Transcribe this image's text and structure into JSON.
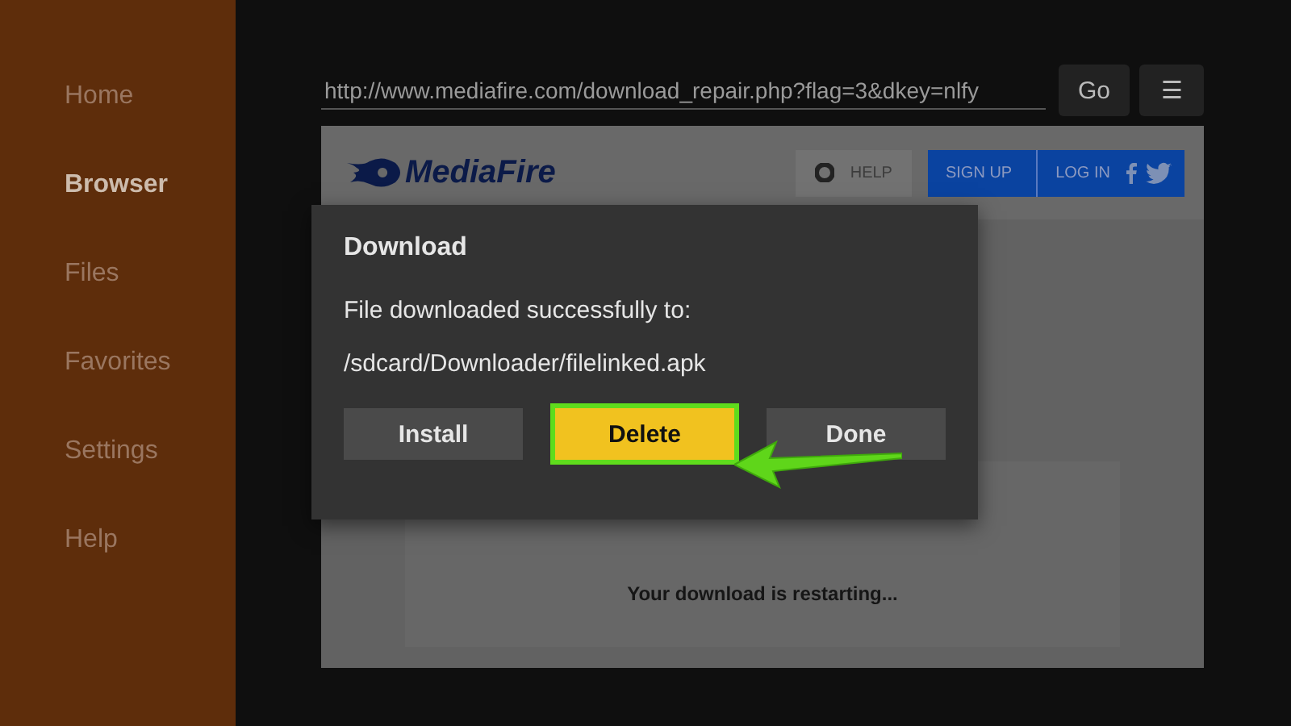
{
  "sidebar": {
    "items": [
      {
        "label": "Home",
        "selected": false
      },
      {
        "label": "Browser",
        "selected": true
      },
      {
        "label": "Files",
        "selected": false
      },
      {
        "label": "Favorites",
        "selected": false
      },
      {
        "label": "Settings",
        "selected": false
      },
      {
        "label": "Help",
        "selected": false
      }
    ]
  },
  "address_bar": {
    "url": "http://www.mediafire.com/download_repair.php?flag=3&dkey=nlfy",
    "go": "Go",
    "menu": "☰"
  },
  "web_page": {
    "logo": "MediaFire",
    "help": "HELP",
    "sign_up": "SIGN UP",
    "log_in": "LOG IN",
    "message": "Your download is restarting..."
  },
  "dialog": {
    "title": "Download",
    "message": "File downloaded successfully to:",
    "path": "/sdcard/Downloader/filelinked.apk",
    "buttons": [
      {
        "label": "Install",
        "selected": false
      },
      {
        "label": "Delete",
        "selected": true
      },
      {
        "label": "Done",
        "selected": false
      }
    ]
  }
}
